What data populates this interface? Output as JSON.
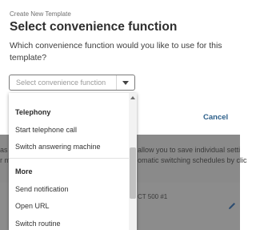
{
  "modal": {
    "overline": "Create New Template",
    "title": "Select convenience function",
    "question": "Which convenience function would you like to use for this template?",
    "select_placeholder": "Select convenience function",
    "cancel_label": "Cancel"
  },
  "dropdown": {
    "groups": [
      {
        "label": "Telephony",
        "items": [
          "Start telephone call",
          "Switch answering machine"
        ]
      },
      {
        "label": "More",
        "items": [
          "Send notification",
          "Open URL",
          "Switch routine"
        ]
      }
    ]
  },
  "background": {
    "line1": "allow you to save individual setti",
    "line2": "omatic switching schedules by clic",
    "left1": "as",
    "left2": "r m",
    "device": "CT 500 #1"
  },
  "colors": {
    "accent": "#2c5f8a",
    "overlay": "#8c8c8c"
  }
}
